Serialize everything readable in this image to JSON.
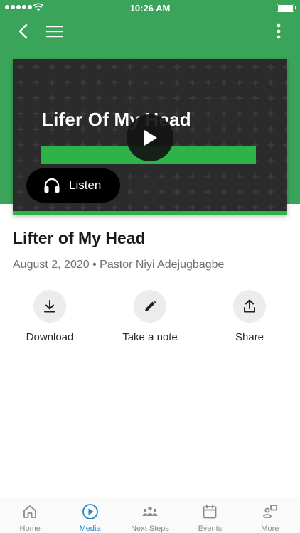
{
  "status_bar": {
    "time": "10:26 AM"
  },
  "media": {
    "artwork_title": "Lifer Of My Head",
    "listen_label": "Listen",
    "title": "Lifter of My Head",
    "date": "August 2, 2020",
    "separator": "•",
    "speaker": "Pastor Niyi Adejugbagbe"
  },
  "actions": {
    "download": "Download",
    "note": "Take a note",
    "share": "Share"
  },
  "tabs": [
    {
      "label": "Home",
      "icon": "home-icon",
      "active": false
    },
    {
      "label": "Media",
      "icon": "play-circle-icon",
      "active": true
    },
    {
      "label": "Next Steps",
      "icon": "people-icon",
      "active": false
    },
    {
      "label": "Events",
      "icon": "calendar-icon",
      "active": false
    },
    {
      "label": "More",
      "icon": "more-grid-icon",
      "active": false
    }
  ],
  "colors": {
    "header_green": "#3aa55a",
    "accent_green": "#2db34a",
    "tab_active": "#1f88c9",
    "tab_inactive": "#8a8a8a"
  }
}
